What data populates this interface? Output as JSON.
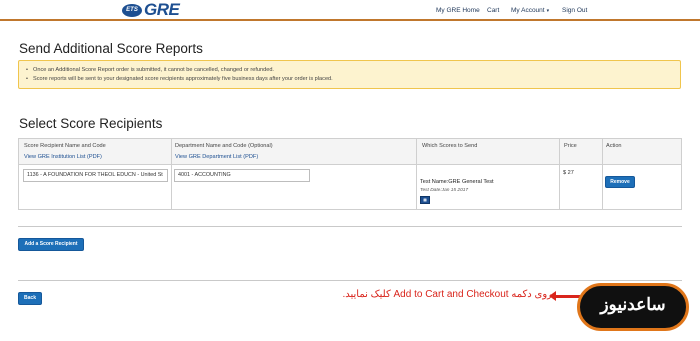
{
  "header": {
    "logo_badge": "ETS",
    "logo_text": "GRE",
    "nav": [
      "My GRE Home",
      "Cart",
      "My Account",
      "Sign Out"
    ],
    "account_caret": "▾"
  },
  "page_title": "Send Additional Score Reports",
  "alert": {
    "items": [
      "Once an Additional Score Report order is submitted, it cannot be cancelled, changed or refunded.",
      "Score reports will be sent to your designated score recipients approximately five business days after your order is placed."
    ]
  },
  "section_title": "Select Score Recipients",
  "table": {
    "headers": {
      "recipient": "Score Recipient Name and Code",
      "recipient_link": "View GRE Institution List (PDF)",
      "department": "Department Name and Code (Optional)",
      "department_link": "View GRE Department List (PDF)",
      "scores": "Which Scores to Send",
      "price": "Price",
      "action": "Action"
    },
    "row": {
      "recipient_value": "1136 - A FOUNDATION FOR THEOL EDUCN - United St",
      "department_value": "4001 - ACCOUNTING",
      "test_name": "Test Name:GRE General Test",
      "test_date": "Test Date:Jan 15 2017",
      "price": "$ 27",
      "remove_label": "Remove"
    }
  },
  "add_recipient_label": "Add a Score Recipient",
  "back_label": "Back",
  "annotation": "روی دکمه Add to Cart and Checkout کلیک نمایید.",
  "watermark": "ساعدنیوز",
  "colors": {
    "accent_orange": "#c0772d",
    "brand_blue": "#1d4f91",
    "button_blue": "#1d6fb8",
    "alert_bg": "#fdf3cf",
    "annotation_red": "#d9251c"
  }
}
